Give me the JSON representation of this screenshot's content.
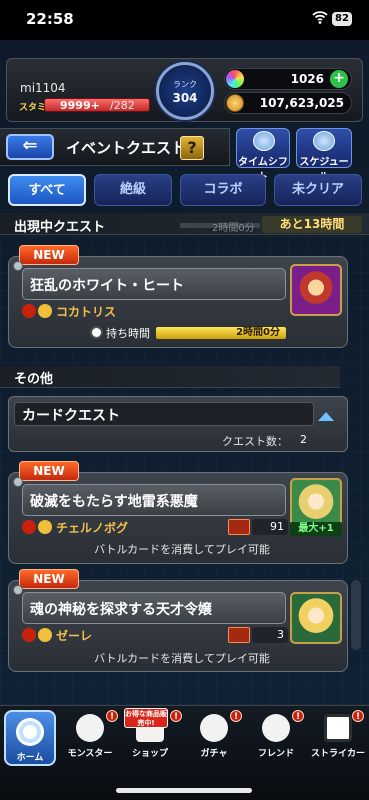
{
  "status_bar": {
    "time": "22:58",
    "battery": "82"
  },
  "player": {
    "name": "mi1104",
    "stamina_label": "スタミナ",
    "stamina_value": "9999+",
    "stamina_max": "/282",
    "rank_label": "ランク",
    "rank_value": "304",
    "orbs": "1026",
    "gold": "107,623,025"
  },
  "page": {
    "title": "イベントクエスト",
    "help": "?",
    "time_shift_label": "タイムシフト",
    "schedule_label": "スケジュール"
  },
  "filters": [
    "すべて",
    "絶級",
    "コラボ",
    "未クリア"
  ],
  "section_active": {
    "title": "出現中クエスト",
    "elapsed": "2時間0分",
    "remaining": "あと13時間"
  },
  "section_other": {
    "title": "その他"
  },
  "quests_active": [
    {
      "badge": "NEW",
      "name": "狂乱のホワイト・ヒート",
      "boss": "コカトリス",
      "timer_label": "持ち時間",
      "timer_value": "2時間0分"
    }
  ],
  "card_quest": {
    "title": "カードクエスト",
    "count_label": "クエスト数：",
    "count": "2"
  },
  "quests_card": [
    {
      "badge": "NEW",
      "name": "破滅をもたらす地雷系悪魔",
      "boss": "チェルノボグ",
      "cards": "91",
      "max_badge": "最大+1",
      "note": "バトルカードを消費してプレイ可能"
    },
    {
      "badge": "NEW",
      "name": "魂の神秘を探求する天才令嬢",
      "boss": "ゼーレ",
      "cards": "3",
      "note": "バトルカードを消費してプレイ可能"
    }
  ],
  "nav": {
    "home": "ホーム",
    "monster": "モンスター",
    "shop": "ショップ",
    "gacha": "ガチャ",
    "friend": "フレンド",
    "striker": "ストライカー",
    "shop_tag": "お得な商品販売中!",
    "alert": "!"
  }
}
